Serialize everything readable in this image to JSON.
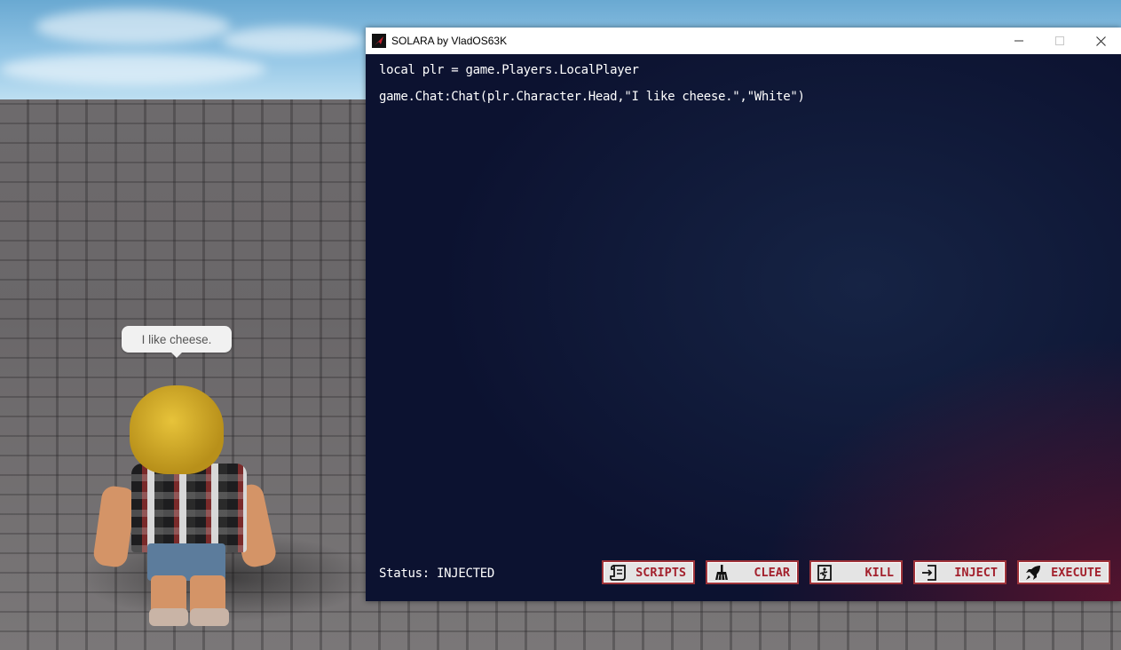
{
  "game": {
    "chat_bubble": "I like cheese."
  },
  "window": {
    "title": "SOLARA by VladOS63K",
    "controls": {
      "minimize": "—",
      "maximize": "☐",
      "close": "✕"
    },
    "editor": {
      "lines": [
        "local plr = game.Players.LocalPlayer",
        "game.Chat:Chat(plr.Character.Head,\"I like cheese.\",\"White\")"
      ]
    },
    "status": "Status: INJECTED",
    "buttons": {
      "scripts": "SCRIPTS",
      "clear": "CLEAR",
      "kill": "KILL",
      "inject": "INJECT",
      "execute": "EXECUTE"
    }
  },
  "colors": {
    "accent": "#a3212d",
    "editor_bg": "#0c1230",
    "button_bg": "#e4e4e4"
  }
}
